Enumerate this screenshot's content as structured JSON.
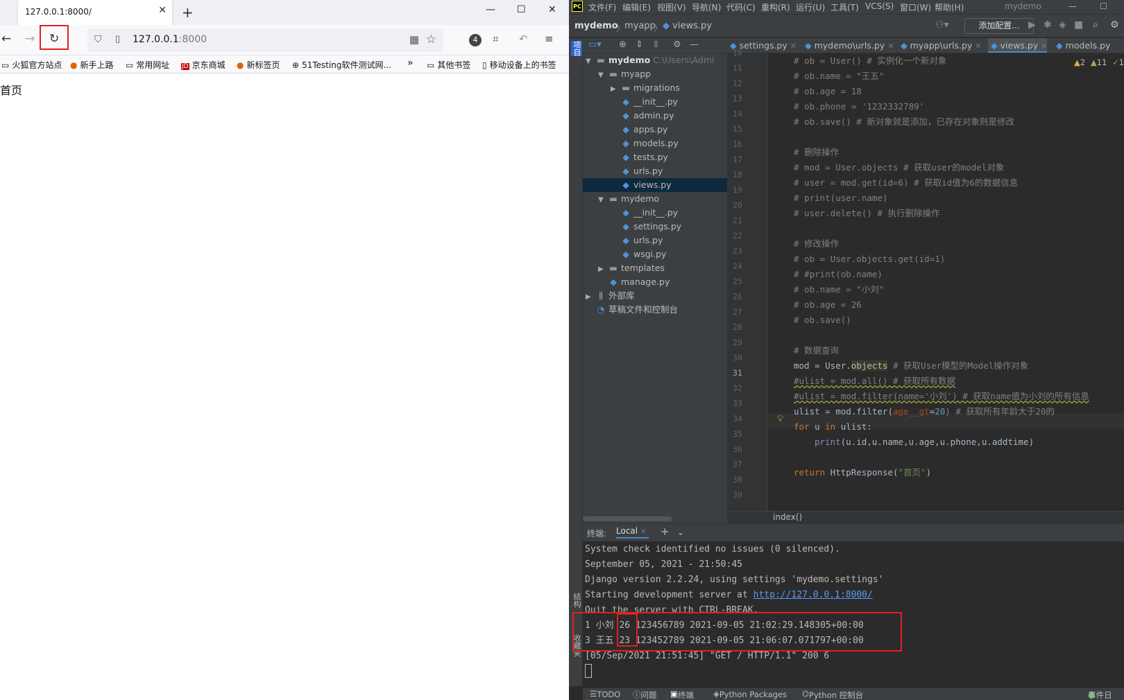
{
  "browser": {
    "tab_title": "127.0.0.1:8000/",
    "url_host": "127.0.0.1",
    "url_port": ":8000",
    "bookmarks": [
      "火狐官方站点",
      "新手上路",
      "常用网址",
      "京东商城",
      "新标签页",
      "51Testing软件测试网...",
      "»",
      "其他书签",
      "移动设备上的书签"
    ],
    "badge_count": "4",
    "page_text": "首页"
  },
  "ide": {
    "menu": [
      "文件(F)",
      "编辑(E)",
      "视图(V)",
      "导航(N)",
      "代码(C)",
      "重构(R)",
      "运行(U)",
      "工具(T)",
      "VCS(S)",
      "窗口(W)",
      "帮助(H)"
    ],
    "project_title": "mydemo",
    "breadcrumb": [
      "mydemo",
      "myapp",
      "views.py"
    ],
    "add_config": "添加配置...",
    "side_labels": [
      "项目",
      "结构",
      "收藏夹"
    ],
    "tree": [
      {
        "label": "mydemo",
        "extra": "C:\\Users\\Admi"
      },
      {
        "label": "myapp"
      },
      {
        "label": "migrations"
      },
      {
        "label": "__init__.py"
      },
      {
        "label": "admin.py"
      },
      {
        "label": "apps.py"
      },
      {
        "label": "models.py"
      },
      {
        "label": "tests.py"
      },
      {
        "label": "urls.py"
      },
      {
        "label": "views.py"
      },
      {
        "label": "mydemo"
      },
      {
        "label": "__init__.py"
      },
      {
        "label": "settings.py"
      },
      {
        "label": "urls.py"
      },
      {
        "label": "wsgi.py"
      },
      {
        "label": "templates"
      },
      {
        "label": "manage.py"
      },
      {
        "label": "外部库"
      },
      {
        "label": "草稿文件和控制台"
      }
    ],
    "tabs": [
      "settings.py",
      "mydemo\\urls.py",
      "myapp\\urls.py",
      "views.py",
      "models.py"
    ],
    "inspections": {
      "warn": "2",
      "weak": "11",
      "ok": "1"
    },
    "line_numbers": [
      "10",
      "11",
      "12",
      "13",
      "14",
      "15",
      "16",
      "17",
      "18",
      "19",
      "20",
      "21",
      "22",
      "23",
      "24",
      "25",
      "26",
      "27",
      "28",
      "29",
      "30",
      "31",
      "32",
      "33",
      "34",
      "35",
      "36",
      "37",
      "38",
      "39"
    ],
    "code": {
      "l10": "# ob = User() # 实例化一个新对象",
      "l11": "# ob.name = \"王五\"",
      "l12": "# ob.age = 18",
      "l13": "# ob.phone = '1232332789'",
      "l14": "# ob.save() # 新对象就是添加，已存在对象则是修改",
      "l16": "# 删除操作",
      "l17": "# mod = User.objects # 获取user的model对象",
      "l18": "# user = mod.get(id=6) # 获取id值为6的数据信息",
      "l19": "# print(user.name)",
      "l20": "# user.delete() # 执行删除操作",
      "l22": "# 修改操作",
      "l23": "# ob = User.objects.get(id=1)",
      "l24": "# #print(ob.name)",
      "l25": "# ob.name = \"小刘\"",
      "l26": "# ob.age = 26",
      "l27": "# ob.save()",
      "l29": "# 数据查询",
      "l30a": "mod = User.",
      "l30b": "objects",
      "l30c": " # 获取User模型的Model操作对象",
      "l31": "#ulist = mod.all() # 获取所有数据",
      "l32": "#ulist = mod.filter(name='小刘') # 获取name值为小刘的所有信息",
      "l33a": "ulist = mod.filter(",
      "l33b": "age__gt",
      "l33c": "=",
      "l33d": "20",
      "l33e": ") # 获取所有年龄大于20的",
      "l34a": "for",
      "l34b": " u ",
      "l34c": "in",
      "l34d": " ulist:",
      "l35a": "print",
      "l35b": "(u.id,u.name,u.age,u.phone,u.addtime)",
      "l37a": "return",
      "l37b": " HttpResponse(",
      "l37c": "\"首页\"",
      "l37d": ")"
    },
    "editor_footer": "index()",
    "terminal_label": "终端:",
    "terminal_tab": "Local",
    "terminal_lines": [
      "System check identified no issues (0 silenced).",
      "September 05, 2021 - 21:50:45",
      "Django version 2.2.24, using settings 'mydemo.settings'",
      "Starting development server at ",
      "Quit the server with CTRL-BREAK.",
      "1 小刘 26 123456789 2021-09-05 21:02:29.148305+00:00",
      "3 王五 23 123452789 2021-09-05 21:06:07.071797+00:00",
      "[05/Sep/2021 21:51:45] \"GET / HTTP/1.1\" 200 6"
    ],
    "server_url": "http://127.0.0.1:8000/",
    "status": [
      "TODO",
      "问题",
      "终端",
      "Python Packages",
      "Python 控制台",
      "事件日"
    ]
  }
}
